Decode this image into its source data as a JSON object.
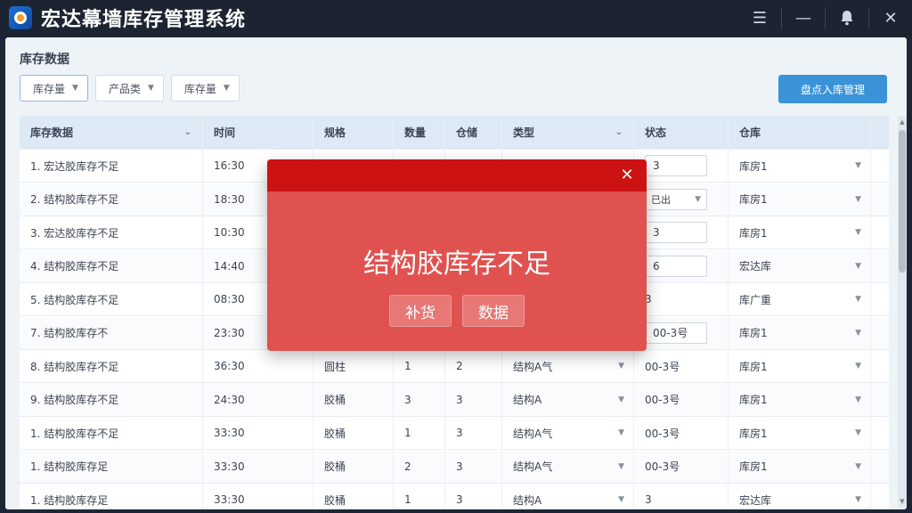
{
  "app": {
    "title": "宏达幕墙库存管理系统"
  },
  "titlebar": {
    "menu_icon": "☰",
    "minimize_icon": "—",
    "bell_icon": "bell-icon",
    "close_icon": "✕"
  },
  "page": {
    "section_title": "库存数据",
    "filters": [
      {
        "label": "库存量"
      },
      {
        "label": "产品类"
      },
      {
        "label": "库存量"
      }
    ],
    "primary_button": "盘点入库管理"
  },
  "table": {
    "headers": [
      "库存数据",
      "时间",
      "规格",
      "数量",
      "仓储",
      "类型",
      "状态",
      "仓库"
    ],
    "rows": [
      {
        "name": "1. 宏达胶库存不足",
        "time": "16:30",
        "spec": "",
        "qty": "",
        "store": "",
        "type": "",
        "status": "3",
        "status_kind": "input",
        "wh": "库房1"
      },
      {
        "name": "2. 结构胶库存不足",
        "time": "18:30",
        "spec": "",
        "qty": "",
        "store": "",
        "type": "",
        "status": "已出",
        "status_kind": "select",
        "wh": "库房1"
      },
      {
        "name": "3. 宏达胶库存不足",
        "time": "10:30",
        "spec": "",
        "qty": "",
        "store": "",
        "type": "",
        "status": "3",
        "status_kind": "input",
        "wh": "库房1"
      },
      {
        "name": "4. 结构胶库存不足",
        "time": "14:40",
        "spec": "",
        "qty": "",
        "store": "",
        "type": "",
        "status": "6",
        "status_kind": "input",
        "wh": "宏达库"
      },
      {
        "name": "5. 结构胶库存不足",
        "time": "08:30",
        "spec": "",
        "qty": "",
        "store": "",
        "type": "",
        "status": "3",
        "status_kind": "text",
        "wh": "库广重"
      },
      {
        "name": "7. 结构胶库存不",
        "time": "23:30",
        "spec": "",
        "qty": "",
        "store": "",
        "type": "",
        "status": "00-3号",
        "status_kind": "input",
        "wh": "库房1"
      },
      {
        "name": "8. 结构胶库存不足",
        "time": "36:30",
        "spec": "圆柱",
        "qty": "1",
        "store": "2",
        "type": "结构A气",
        "status": "00-3号",
        "status_kind": "text",
        "wh": "库房1"
      },
      {
        "name": "9. 结构胶库存不足",
        "time": "24:30",
        "spec": "胶桶",
        "qty": "3",
        "store": "3",
        "type": "结构A",
        "status": "00-3号",
        "status_kind": "text",
        "wh": "库房1"
      },
      {
        "name": "1. 结构胶库存不足",
        "time": "33:30",
        "spec": "胶桶",
        "qty": "1",
        "store": "3",
        "type": "结构A气",
        "status": "00-3号",
        "status_kind": "text",
        "wh": "库房1"
      },
      {
        "name": "1. 结构胶库存足",
        "time": "33:30",
        "spec": "胶桶",
        "qty": "2",
        "store": "3",
        "type": "结构A气",
        "status": "00-3号",
        "status_kind": "text",
        "wh": "库房1"
      },
      {
        "name": "1. 结构胶库存足",
        "time": "33:30",
        "spec": "胶桶",
        "qty": "1",
        "store": "3",
        "type": "结构A",
        "status": "3",
        "status_kind": "text",
        "wh": "宏达库"
      }
    ]
  },
  "dialog": {
    "message": "结构胶库存不足",
    "buttons": [
      "补货",
      "数据"
    ]
  }
}
